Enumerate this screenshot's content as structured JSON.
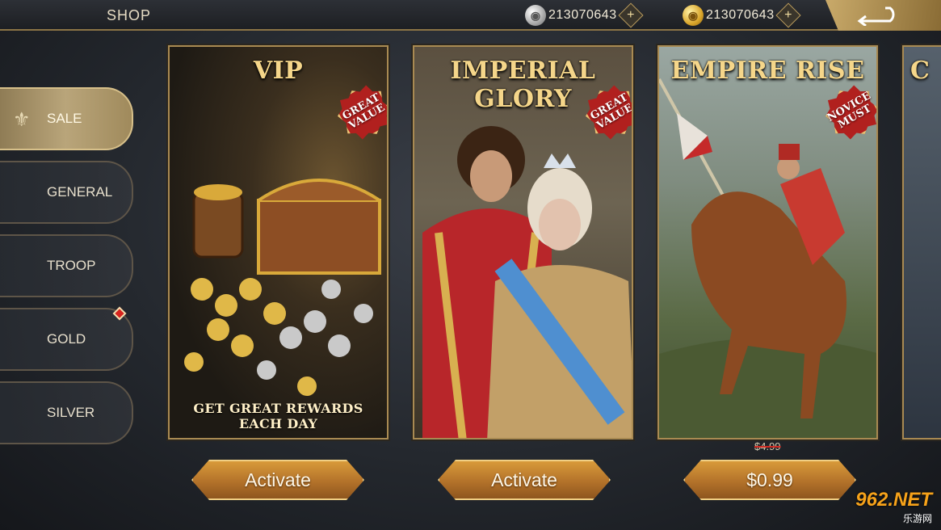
{
  "header": {
    "title": "SHOP",
    "silver_amount": "213070643",
    "gold_amount": "213070643",
    "add_symbol": "+"
  },
  "sidebar": {
    "items": [
      {
        "label": "SALE",
        "active": true
      },
      {
        "label": "GENERAL"
      },
      {
        "label": "TROOP"
      },
      {
        "label": "GOLD",
        "has_alert": true
      },
      {
        "label": "SILVER"
      }
    ]
  },
  "cards": [
    {
      "title": "VIP",
      "badge": "GREAT VALUE",
      "footer": "GET GREAT REWARDS EACH DAY",
      "button": "Activate"
    },
    {
      "title": "IMPERIAL GLORY",
      "badge": "GREAT VALUE",
      "button": "Activate"
    },
    {
      "title": "EMPIRE RISE",
      "badge": "NOVICE MUST",
      "old_price": "$4.99",
      "button": "$0.99"
    },
    {
      "title": "C"
    }
  ],
  "watermark": {
    "brand": "962.NET",
    "sub": "乐游网"
  },
  "icons": {
    "silver": "silver-coin-icon",
    "gold": "gold-coin-icon",
    "back": "back-arrow-icon",
    "sale": "fleur-de-lis-icon"
  },
  "colors": {
    "accent_gold": "#d7c08a",
    "button": "#c6852f",
    "badge_red": "#b1201e"
  }
}
